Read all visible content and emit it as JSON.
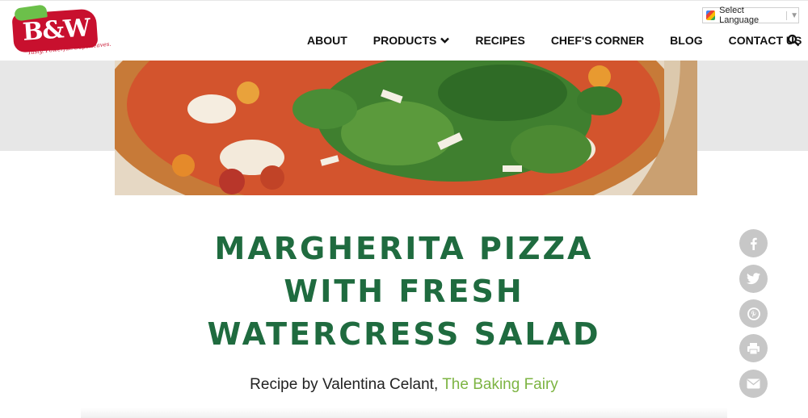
{
  "brand": {
    "logo_text": "B&W",
    "tagline": "Tasty. Powerful. Superleaves.",
    "colors": {
      "red": "#c8102e",
      "green": "#6cc04a",
      "title_green": "#1f6b3f",
      "link_green": "#7db443"
    }
  },
  "translate": {
    "label": "Select Language",
    "arrow": "▼"
  },
  "nav": {
    "items": [
      {
        "label": "ABOUT"
      },
      {
        "label": "PRODUCTS",
        "icon": "chevron-down-icon"
      },
      {
        "label": "RECIPES"
      },
      {
        "label": "CHEF'S CORNER"
      },
      {
        "label": "BLOG"
      },
      {
        "label": "CONTACT US"
      }
    ],
    "search_icon": "search-icon"
  },
  "hero": {
    "image": "margherita-pizza-with-watercress-photo"
  },
  "recipe": {
    "title_lines": [
      "MARGHERITA PIZZA",
      "WITH FRESH",
      "WATERCRESS SALAD"
    ],
    "byline_prefix": "Recipe by Valentina Celant, ",
    "byline_link": "The Baking Fairy"
  },
  "social": [
    "facebook-icon",
    "twitter-icon",
    "pinterest-icon",
    "print-icon",
    "email-icon"
  ]
}
